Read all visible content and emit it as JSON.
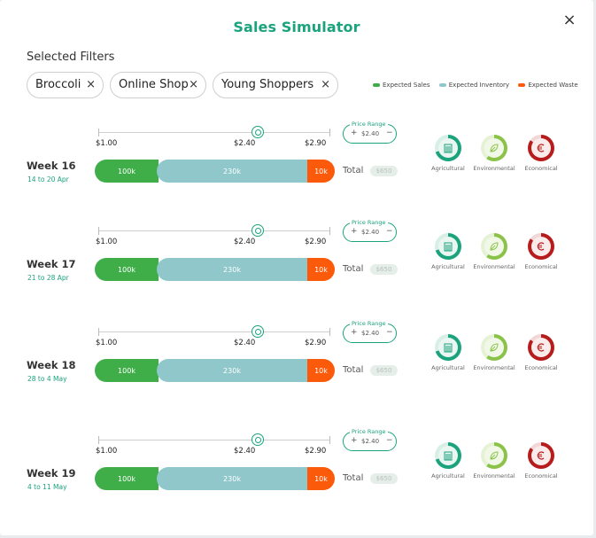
{
  "title": "Sales Simulator",
  "close_icon": "×",
  "filters_label": "Selected Filters",
  "filters": [
    {
      "label": "Broccoli",
      "remove": "×"
    },
    {
      "label": "Online Shop",
      "remove": "×"
    },
    {
      "label": "Young Shoppers",
      "remove": "×"
    }
  ],
  "legend": [
    {
      "label": "Expected Sales",
      "color": "#3fae49"
    },
    {
      "label": "Expected Inventory",
      "color": "#8fc7cb"
    },
    {
      "label": "Expected Waste",
      "color": "#fb5a0a"
    }
  ],
  "colors": {
    "accent": "#1aa37d",
    "sales": "#3fae49",
    "inventory": "#8fc7cb",
    "waste": "#fb5a0a",
    "environmental": "#8bc34a",
    "economical": "#b71c1c"
  },
  "weeks": [
    {
      "title": "Week 16",
      "dates": "14 to 20 Apr",
      "min": "$1.00",
      "current": "$2.40",
      "max": "$2.90",
      "price_range_label": "Price Range",
      "price_value": "$2.40",
      "plus": "+",
      "minus": "−",
      "sales": "100k",
      "inventory": "230k",
      "waste": "10k",
      "total_label": "Total",
      "total_value": "$650",
      "indicators": [
        "Agricultural",
        "Environmental",
        "Economical"
      ]
    },
    {
      "title": "Week 17",
      "dates": "21 to 28 Apr",
      "min": "$1.00",
      "current": "$2.40",
      "max": "$2.90",
      "price_range_label": "Price Range",
      "price_value": "$2.40",
      "plus": "+",
      "minus": "−",
      "sales": "100k",
      "inventory": "230k",
      "waste": "10k",
      "total_label": "Total",
      "total_value": "$650",
      "indicators": [
        "Agricultural",
        "Environmental",
        "Economical"
      ]
    },
    {
      "title": "Week 18",
      "dates": "28 to 4 May",
      "min": "$1.00",
      "current": "$2.40",
      "max": "$2.90",
      "price_range_label": "Price Range",
      "price_value": "$2.40",
      "plus": "+",
      "minus": "−",
      "sales": "100k",
      "inventory": "230k",
      "waste": "10k",
      "total_label": "Total",
      "total_value": "$650",
      "indicators": [
        "Agricultural",
        "Environmental",
        "Economical"
      ]
    },
    {
      "title": "Week 19",
      "dates": "4 to 11 May",
      "min": "$1.00",
      "current": "$2.40",
      "max": "$2.90",
      "price_range_label": "Price Range",
      "price_value": "$2.40",
      "plus": "+",
      "minus": "−",
      "sales": "100k",
      "inventory": "230k",
      "waste": "10k",
      "total_label": "Total",
      "total_value": "$650",
      "indicators": [
        "Agricultural",
        "Environmental",
        "Economical"
      ]
    }
  ]
}
